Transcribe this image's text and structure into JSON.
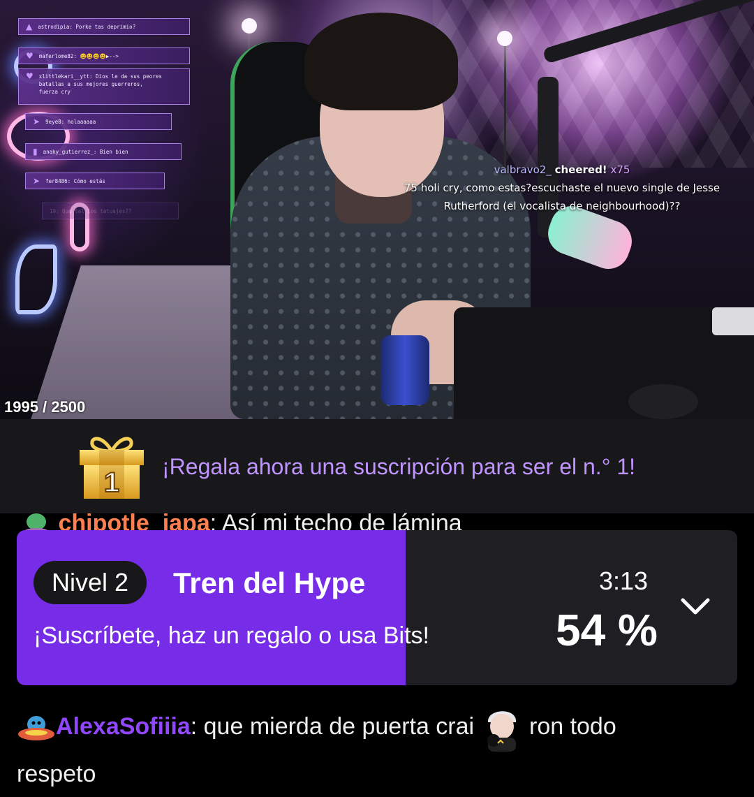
{
  "stream": {
    "overlay_chat": [
      {
        "icon": "warning-icon",
        "text": "astrodipia: Porke tas deprimio?"
      },
      {
        "icon": "heart-icon",
        "text": "maferlome82: 😀😀😀😀▶-->"
      },
      {
        "icon": "heart-icon",
        "text": "xlittlekari__ytt: Dios le da sus peores batallas a sus mejores guerreros, fuerza cry"
      },
      {
        "icon": "rocket-icon",
        "text": "9eye8: holaaaaaa"
      },
      {
        "icon": "signal-icon",
        "text": "anahy_gutierrez_: Bien bien"
      },
      {
        "icon": "rocket-icon",
        "text": "fer8486: Cómo estás"
      },
      {
        "icon": "",
        "text": "19: Que tal los tatuajes??"
      }
    ],
    "cheer": {
      "user": "valbravo2_",
      "action": "cheered!",
      "amount": "x75",
      "message": "75 holi cry, como estas?escuchaste el nuevo single de Jesse Rutherford (el vocalista de neighbourhood)??"
    },
    "goal_counter": "1995 / 2500"
  },
  "gift_banner": {
    "rank": "1",
    "text": "¡Regala ahora una suscripción para ser el n.° 1!"
  },
  "chat": {
    "partial_line": {
      "user": "chipotle_japa",
      "sep": ":",
      "text": " Así mi techo de lámina"
    },
    "line": {
      "user": "AlexaSofiiia",
      "sep": ":",
      "text_before": " que mierda de puerta crai ",
      "text_after": " ron todo",
      "text_wrap": "respeto"
    }
  },
  "hype_train": {
    "level": "Nivel 2",
    "title": "Tren del Hype",
    "subtitle": "¡Suscríbete, haz un regalo o usa Bits!",
    "time": "3:13",
    "percent_label": "54 %",
    "progress": 0.54
  },
  "colors": {
    "accent": "#772ce8",
    "gift_text": "#bf94ff",
    "username_orange": "#ff7f50",
    "username_purple": "#9147ff"
  }
}
